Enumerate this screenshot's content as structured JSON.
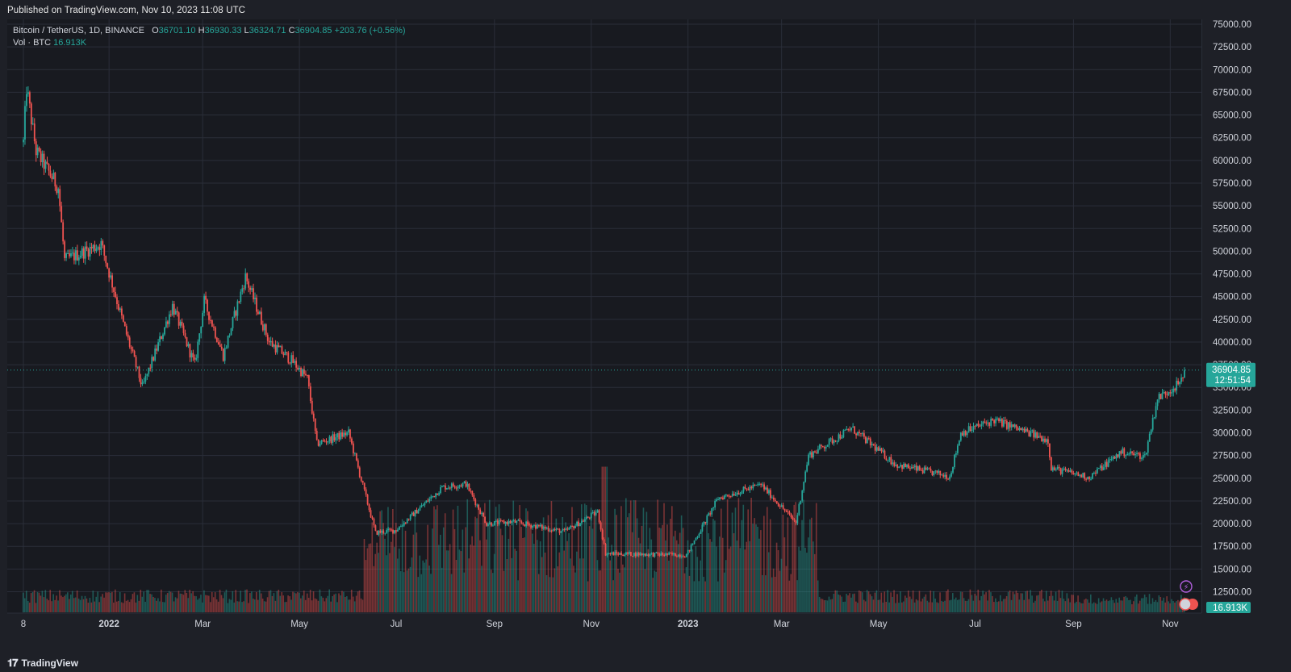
{
  "header": {
    "published": "Published on TradingView.com, Nov 10, 2023 11:08 UTC"
  },
  "legend": {
    "symbol": "Bitcoin / TetherUS, 1D, BINANCE",
    "open_label": "O",
    "open": "36701.10",
    "high_label": "H",
    "high": "36930.33",
    "low_label": "L",
    "low": "36324.71",
    "close_label": "C",
    "close": "36904.85",
    "change": "+203.76 (+0.56%)",
    "vol_label": "Vol · BTC",
    "vol_value": "16.913K"
  },
  "price_label": {
    "price": "36904.85",
    "countdown": "12:51:54"
  },
  "volume_label": "16.913K",
  "footer": {
    "brand": "TradingView"
  },
  "colors": {
    "up": "#26a69a",
    "down": "#ef5350",
    "background": "#181a20",
    "grid": "#2a2e39",
    "axis_text": "#d1d4dc",
    "price_line": "#26a69a"
  },
  "chart_data": {
    "type": "candlestick",
    "symbol": "Bitcoin / TetherUS",
    "interval": "1D",
    "exchange": "BINANCE",
    "y_axis": {
      "min": 10000,
      "max": 75000,
      "ticks": [
        "75000.00",
        "72500.00",
        "70000.00",
        "67500.00",
        "65000.00",
        "62500.00",
        "60000.00",
        "57500.00",
        "55000.00",
        "52500.00",
        "50000.00",
        "47500.00",
        "45000.00",
        "42500.00",
        "40000.00",
        "37500.00",
        "35000.00",
        "32500.00",
        "30000.00",
        "27500.00",
        "25000.00",
        "22500.00",
        "20000.00",
        "17500.00",
        "15000.00",
        "12500.00"
      ]
    },
    "x_axis": {
      "range": [
        "2021-11-08",
        "2023-11-10"
      ],
      "ticks": [
        {
          "date": "2021-11-08",
          "label": "8"
        },
        {
          "date": "2022-01-01",
          "label": "2022",
          "bold": true
        },
        {
          "date": "2022-03-01",
          "label": "Mar"
        },
        {
          "date": "2022-05-01",
          "label": "May"
        },
        {
          "date": "2022-07-01",
          "label": "Jul"
        },
        {
          "date": "2022-09-01",
          "label": "Sep"
        },
        {
          "date": "2022-11-01",
          "label": "Nov"
        },
        {
          "date": "2023-01-01",
          "label": "2023",
          "bold": true
        },
        {
          "date": "2023-03-01",
          "label": "Mar"
        },
        {
          "date": "2023-05-01",
          "label": "May"
        },
        {
          "date": "2023-07-01",
          "label": "Jul"
        },
        {
          "date": "2023-09-01",
          "label": "Sep"
        },
        {
          "date": "2023-11-01",
          "label": "Nov"
        }
      ]
    },
    "price_anchors": [
      {
        "date": "2021-11-08",
        "close": 62000
      },
      {
        "date": "2021-11-10",
        "close": 68000
      },
      {
        "date": "2021-11-16",
        "close": 61000
      },
      {
        "date": "2021-11-30",
        "close": 57000
      },
      {
        "date": "2021-12-04",
        "close": 49000
      },
      {
        "date": "2021-12-27",
        "close": 50800
      },
      {
        "date": "2022-01-10",
        "close": 42000
      },
      {
        "date": "2022-01-22",
        "close": 35000
      },
      {
        "date": "2022-02-10",
        "close": 44000
      },
      {
        "date": "2022-02-24",
        "close": 37500
      },
      {
        "date": "2022-03-02",
        "close": 44500
      },
      {
        "date": "2022-03-14",
        "close": 38500
      },
      {
        "date": "2022-03-28",
        "close": 47200
      },
      {
        "date": "2022-04-12",
        "close": 40000
      },
      {
        "date": "2022-04-26",
        "close": 38000
      },
      {
        "date": "2022-05-06",
        "close": 36000
      },
      {
        "date": "2022-05-12",
        "close": 28800
      },
      {
        "date": "2022-06-01",
        "close": 30000
      },
      {
        "date": "2022-06-18",
        "close": 19000
      },
      {
        "date": "2022-07-01",
        "close": 19300
      },
      {
        "date": "2022-07-30",
        "close": 24000
      },
      {
        "date": "2022-08-14",
        "close": 24400
      },
      {
        "date": "2022-08-27",
        "close": 20000
      },
      {
        "date": "2022-09-13",
        "close": 20200
      },
      {
        "date": "2022-10-15",
        "close": 19100
      },
      {
        "date": "2022-11-05",
        "close": 21300
      },
      {
        "date": "2022-11-10",
        "close": 16700
      },
      {
        "date": "2022-12-31",
        "close": 16550
      },
      {
        "date": "2023-01-20",
        "close": 22800
      },
      {
        "date": "2023-02-16",
        "close": 24300
      },
      {
        "date": "2023-03-10",
        "close": 20100
      },
      {
        "date": "2023-03-18",
        "close": 27500
      },
      {
        "date": "2023-04-14",
        "close": 30500
      },
      {
        "date": "2023-05-12",
        "close": 26500
      },
      {
        "date": "2023-06-15",
        "close": 25200
      },
      {
        "date": "2023-06-22",
        "close": 30000
      },
      {
        "date": "2023-07-13",
        "close": 31400
      },
      {
        "date": "2023-08-16",
        "close": 29200
      },
      {
        "date": "2023-08-18",
        "close": 26100
      },
      {
        "date": "2023-09-11",
        "close": 25100
      },
      {
        "date": "2023-10-01",
        "close": 27900
      },
      {
        "date": "2023-10-16",
        "close": 27400
      },
      {
        "date": "2023-10-24",
        "close": 33800
      },
      {
        "date": "2023-11-08",
        "close": 35600
      },
      {
        "date": "2023-11-10",
        "close": 36904.85
      }
    ],
    "last_price": 36904.85,
    "last_volume": "16.913K"
  }
}
